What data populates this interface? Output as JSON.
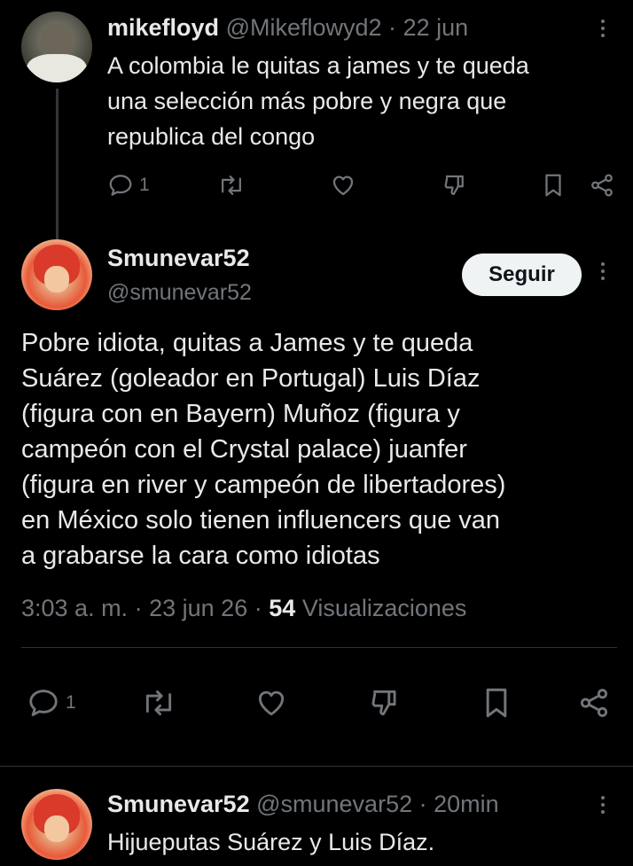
{
  "reply_parent": {
    "display_name": "mikefloyd",
    "handle": "@Mikeflowyd2",
    "separator": "·",
    "time": "22 jun",
    "text_lines": [
      "A colombia le quitas a james y te queda",
      "una selección más pobre y negra que",
      "republica del congo"
    ],
    "reply_count": "1"
  },
  "main_tweet": {
    "display_name": "Smunevar52",
    "handle": "@smunevar52",
    "follow_label": "Seguir",
    "text_lines": [
      "Pobre idiota, quitas a James y te queda",
      "Suárez (goleador en Portugal) Luis Díaz",
      "(figura con en Bayern) Muñoz (figura y",
      "campeón con el Crystal palace) juanfer",
      "(figura en river y campeón de libertadores)",
      "en México solo tienen influencers que van",
      "a grabarse la cara como idiotas"
    ],
    "time": "3:03 a. m.",
    "sep1": "·",
    "date": "23 jun 26",
    "sep2": "·",
    "views_count": "54",
    "views_label": "Visualizaciones",
    "reply_count": "1"
  },
  "reply_child": {
    "display_name": "Smunevar52",
    "handle": "@smunevar52",
    "separator": "·",
    "time": "20min",
    "text": "Hijueputas Suárez y Luis Díaz."
  },
  "colors": {
    "background": "#000000",
    "text": "#e7e9ea",
    "muted": "#71767b",
    "divider": "#2f3336",
    "button_bg": "#eff3f4"
  }
}
